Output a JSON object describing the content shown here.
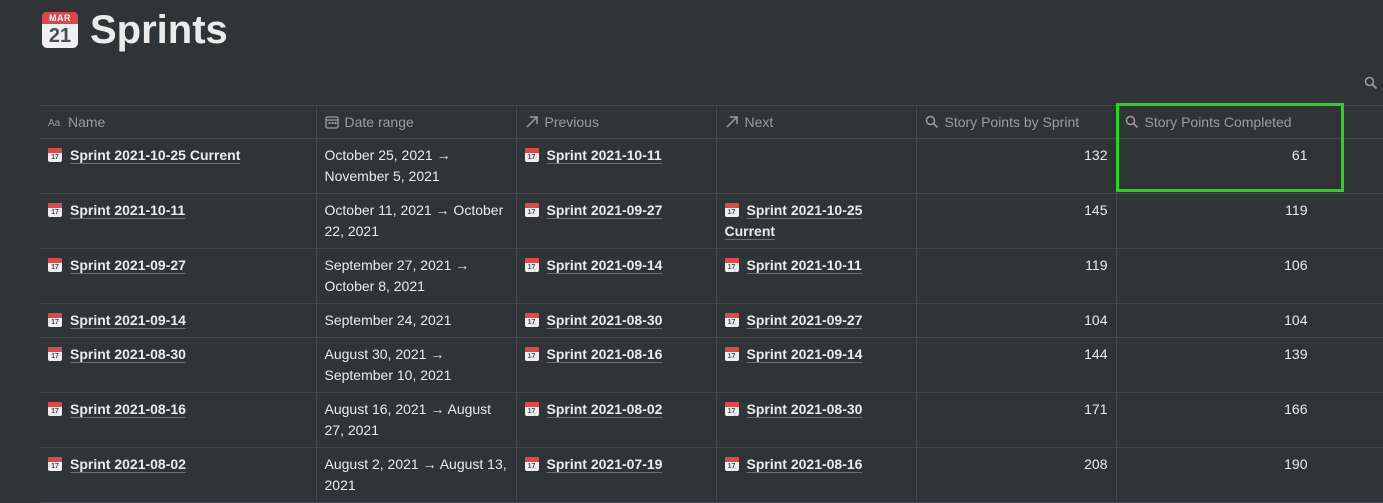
{
  "page": {
    "title": "Sprints",
    "title_icon": "calendar-icon",
    "title_icon_month": "MAR",
    "title_icon_day": "21"
  },
  "columns": [
    {
      "label": "Name",
      "icon": "text-property-icon"
    },
    {
      "label": "Date range",
      "icon": "calendar-property-icon"
    },
    {
      "label": "Previous",
      "icon": "relation-arrow-icon"
    },
    {
      "label": "Next",
      "icon": "relation-arrow-icon"
    },
    {
      "label": "Story Points by Sprint",
      "icon": "rollup-search-icon"
    },
    {
      "label": "Story Points Completed",
      "icon": "rollup-search-icon"
    }
  ],
  "rows": [
    {
      "name": "Sprint 2021-10-25 Current",
      "date_range": "October 25, 2021 → November 5, 2021",
      "previous": "Sprint 2021-10-11",
      "next": "",
      "points": "132",
      "completed": "61"
    },
    {
      "name": "Sprint 2021-10-11",
      "date_range": "October 11, 2021 → October 22, 2021",
      "previous": "Sprint 2021-09-27",
      "next": "Sprint 2021-10-25 Current",
      "points": "145",
      "completed": "119"
    },
    {
      "name": "Sprint 2021-09-27",
      "date_range": "September 27, 2021 → October 8, 2021",
      "previous": "Sprint 2021-09-14",
      "next": "Sprint 2021-10-11",
      "points": "119",
      "completed": "106"
    },
    {
      "name": "Sprint 2021-09-14",
      "date_range": "September 24, 2021",
      "previous": "Sprint 2021-08-30",
      "next": "Sprint 2021-09-27",
      "points": "104",
      "completed": "104"
    },
    {
      "name": "Sprint 2021-08-30",
      "date_range": "August 30, 2021 → September 10, 2021",
      "previous": "Sprint 2021-08-16",
      "next": "Sprint 2021-09-14",
      "points": "144",
      "completed": "139"
    },
    {
      "name": "Sprint 2021-08-16",
      "date_range": "August 16, 2021 → August 27, 2021",
      "previous": "Sprint 2021-08-02",
      "next": "Sprint 2021-08-30",
      "points": "171",
      "completed": "166"
    },
    {
      "name": "Sprint 2021-08-02",
      "date_range": "August 2, 2021 → August 13, 2021",
      "previous": "Sprint 2021-07-19",
      "next": "Sprint 2021-08-16",
      "points": "208",
      "completed": "190"
    }
  ],
  "colors": {
    "background": "#2f3437",
    "text": "#ebebea",
    "muted": "#9b9c9e",
    "highlight": "#1fdc13"
  }
}
